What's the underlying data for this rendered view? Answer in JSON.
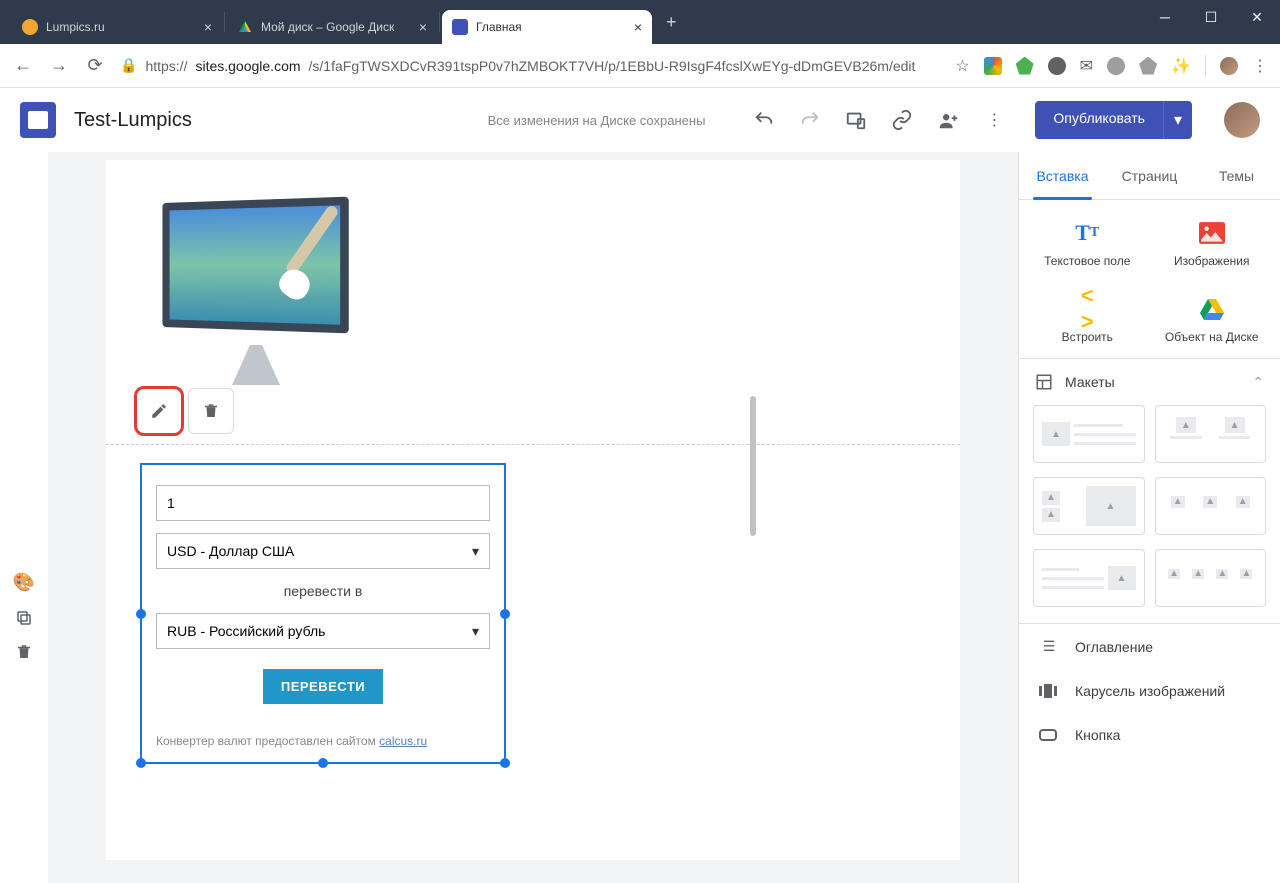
{
  "browser": {
    "tabs": [
      {
        "title": "Lumpics.ru",
        "iconColor": "#f0a830"
      },
      {
        "title": "Мой диск – Google Диск",
        "iconColor": "#0f9d58"
      },
      {
        "title": "Главная",
        "iconColor": "#3f51b5",
        "active": true
      }
    ],
    "url_proto": "https://",
    "url_host": "sites.google.com",
    "url_path": "/s/1faFgTWSXDCvR391tspP0v7hZMBOKT7VH/p/1EBbU-R9IsgF4fcslXwEYg-dDmGEVB26m/edit"
  },
  "sites": {
    "title": "Test-Lumpics",
    "saveStatus": "Все изменения на Диске сохранены",
    "publish": "Опубликовать"
  },
  "converter": {
    "amount": "1",
    "from": "USD - Доллар США",
    "convertLabel": "перевести в",
    "to": "RUB - Российский рубль",
    "button": "ПЕРЕВЕСТИ",
    "creditPrefix": "Конвертер валют предоставлен сайтом ",
    "creditLink": "calcus.ru"
  },
  "panel": {
    "tabs": {
      "insert": "Вставка",
      "pages": "Страниц",
      "themes": "Темы"
    },
    "insert": {
      "textBox": "Текстовое поле",
      "images": "Изображения",
      "embed": "Встроить",
      "drive": "Объект на Диске"
    },
    "layoutsHeader": "Макеты",
    "list": {
      "toc": "Оглавление",
      "carousel": "Карусель изображений",
      "button": "Кнопка"
    }
  }
}
